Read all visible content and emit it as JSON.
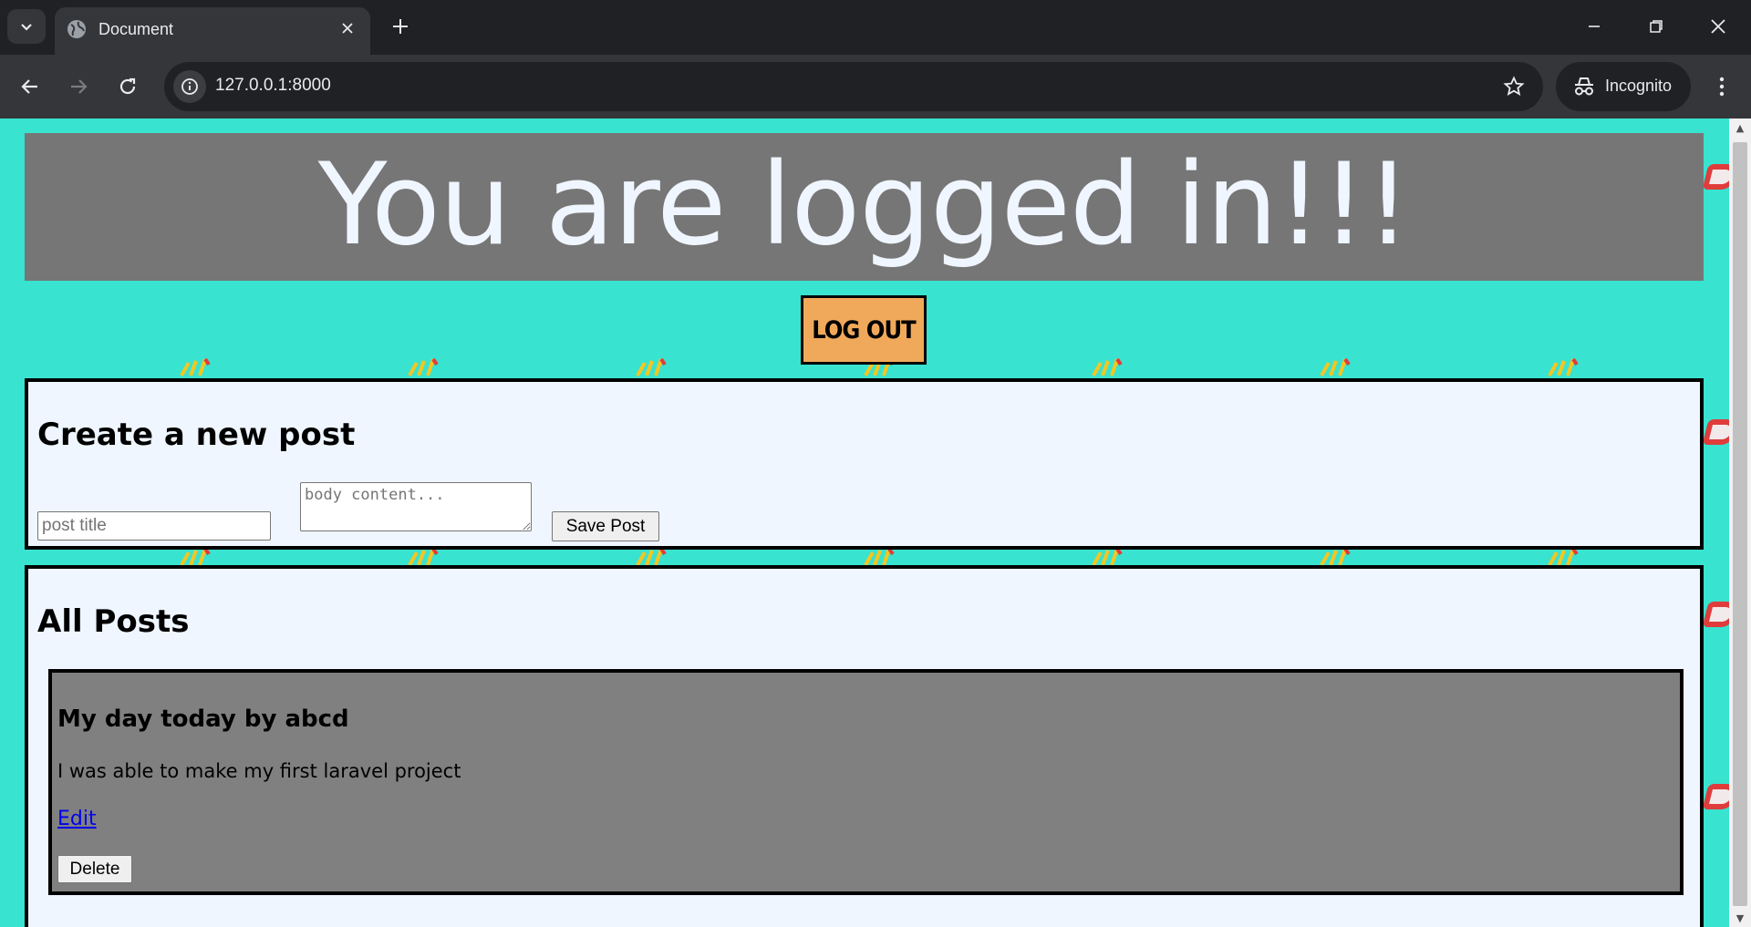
{
  "browser": {
    "tab_title": "Document",
    "url": "127.0.0.1:8000",
    "profile_label": "Incognito"
  },
  "page": {
    "banner_title": "You are logged in!!!",
    "logout_label": "LOG OUT",
    "create_post": {
      "heading": "Create a new post",
      "title_placeholder": "post title",
      "body_placeholder": "body content...",
      "save_label": "Save Post"
    },
    "all_posts": {
      "heading": "All Posts",
      "posts": [
        {
          "title": "My day today by abcd",
          "body": "I was able to make my first laravel project",
          "edit_label": "Edit",
          "delete_label": "Delete"
        }
      ]
    }
  },
  "colors": {
    "page_background": "#38e3d0",
    "banner_background": "#767676",
    "logout_background": "#f0a95b",
    "panel_background": "#eff6ff",
    "post_card_background": "#808080"
  }
}
